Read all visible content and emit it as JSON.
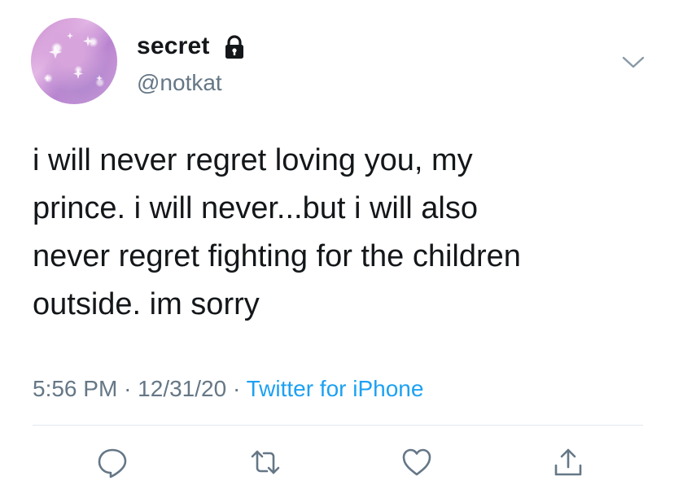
{
  "user": {
    "display_name": "secret",
    "handle": "@notkat",
    "avatar_icon": "avatar-image",
    "protected_icon": "lock-icon"
  },
  "tweet": {
    "text": "i will never regret loving you, my\nprince. i will never...but i will also\nnever regret fighting for the children\noutside. im sorry",
    "time": "5:56 PM",
    "date": "12/31/20",
    "separator": "·",
    "source": "Twitter for iPhone"
  },
  "actions": [
    {
      "name": "reply",
      "icon": "reply-icon"
    },
    {
      "name": "retweet",
      "icon": "retweet-icon"
    },
    {
      "name": "like",
      "icon": "heart-icon"
    },
    {
      "name": "share",
      "icon": "share-icon"
    }
  ],
  "colors": {
    "text": "#14171a",
    "secondary": "#657786",
    "link": "#1da1f2",
    "divider": "#e1e8ed"
  }
}
